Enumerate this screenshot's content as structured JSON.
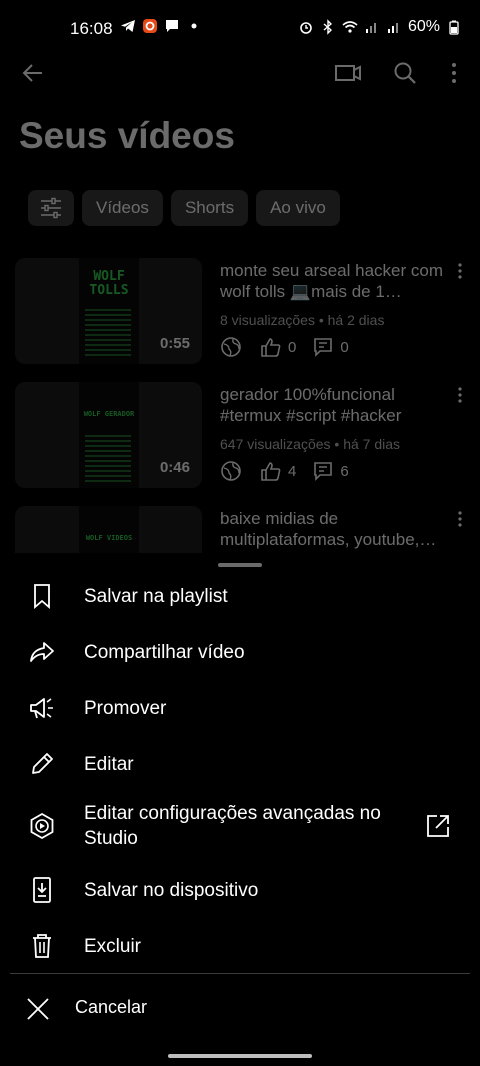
{
  "status_bar": {
    "time": "16:08",
    "battery": "60%"
  },
  "header": {
    "title": "Seus vídeos"
  },
  "chips": [
    {
      "label": "Vídeos"
    },
    {
      "label": "Shorts"
    },
    {
      "label": "Ao vivo"
    }
  ],
  "videos": [
    {
      "title": "monte seu arseal hacker com wolf tolls 💻mais de 1…",
      "meta": "8 visualizações • há 2 dias",
      "duration": "0:55",
      "likes": "0",
      "comments": "0",
      "thumb_text": "WOLF TOLLS"
    },
    {
      "title": "gerador 100%funcional #termux #script #hacker",
      "meta": "647 visualizações • há 7 dias",
      "duration": "0:46",
      "likes": "4",
      "comments": "6",
      "thumb_text": "WOLF GERADOR"
    },
    {
      "title": "baixe midias de multiplataformas, youtube,…",
      "thumb_text": "WOLF VIDEOS"
    }
  ],
  "menu": {
    "items": [
      {
        "label": "Salvar na playlist",
        "icon": "bookmark-icon"
      },
      {
        "label": "Compartilhar vídeo",
        "icon": "share-icon"
      },
      {
        "label": "Promover",
        "icon": "megaphone-icon"
      },
      {
        "label": "Editar",
        "icon": "pencil-icon"
      },
      {
        "label": "Editar configurações avançadas no Studio",
        "icon": "studio-icon"
      },
      {
        "label": "Salvar no dispositivo",
        "icon": "download-icon"
      },
      {
        "label": "Excluir",
        "icon": "trash-icon"
      }
    ],
    "cancel_label": "Cancelar"
  },
  "colors": {
    "background": "#000000",
    "chip": "#3a3a3a",
    "thumb_green": "#39d353",
    "meta_text": "#bdbdbd"
  }
}
